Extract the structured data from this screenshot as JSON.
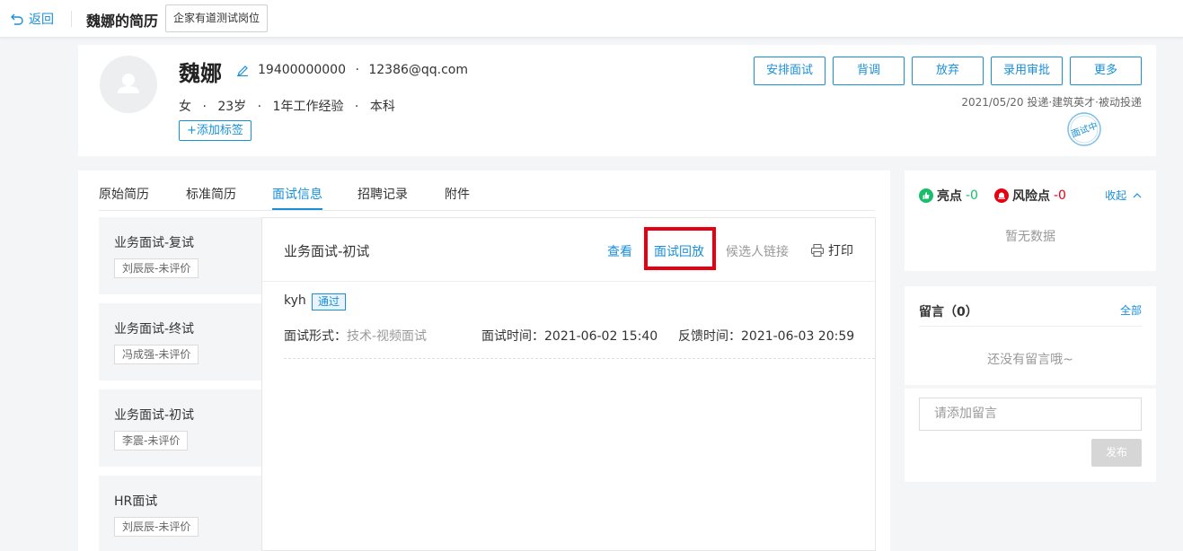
{
  "topbar": {
    "back_label": "返回",
    "page_title": "魏娜的简历",
    "job_tag": "企家有道测试岗位"
  },
  "candidate": {
    "name": "魏娜",
    "phone": "19400000000",
    "email": "12386@qq.com",
    "contact_sep": "·",
    "gender": "女",
    "age": "23岁",
    "experience": "1年工作经验",
    "education": "本科",
    "add_tag_label": "+添加标签",
    "source_line": "2021/05/20 投递·建筑英才·被动投递",
    "stamp_text": "面试中"
  },
  "actions": [
    "安排面试",
    "背调",
    "放弃",
    "录用审批",
    "更多"
  ],
  "tabs": [
    "原始简历",
    "标准简历",
    "面试信息",
    "招聘记录",
    "附件"
  ],
  "active_tab": "面试信息",
  "rounds": [
    {
      "title": "业务面试-复试",
      "tag": "刘辰辰-未评价"
    },
    {
      "title": "业务面试-终试",
      "tag": "冯成强-未评价"
    },
    {
      "title": "业务面试-初试",
      "tag": "李震-未评价"
    },
    {
      "title": "HR面试",
      "tag": "刘辰辰-未评价"
    }
  ],
  "detail": {
    "title": "业务面试-初试",
    "view_label": "查看",
    "replay_label": "面试回放",
    "candidate_link_label": "候选人链接",
    "print_label": "打印",
    "interviewer": "kyh",
    "result_badge": "通过",
    "form_label": "面试形式：",
    "form_value": "技术-视频面试",
    "time_label": "面试时间：",
    "time_value": "2021-06-02 15:40",
    "feedback_label": "反馈时间：",
    "feedback_value": "2021-06-03 20:59"
  },
  "highlights": {
    "highlight_label": "亮点",
    "highlight_count": "-0",
    "risk_label": "风险点",
    "risk_count": "-0",
    "collapse_label": "收起",
    "empty_text": "暂无数据"
  },
  "messages": {
    "title": "留言（0）",
    "all_label": "全部",
    "empty_text": "还没有留言哦~",
    "input_placeholder": "请添加留言",
    "publish_label": "发布"
  },
  "colors": {
    "accent": "#1890d8",
    "highlight_green": "#19be6b",
    "risk_red": "#e60012",
    "annotation_box": "#e60012"
  }
}
